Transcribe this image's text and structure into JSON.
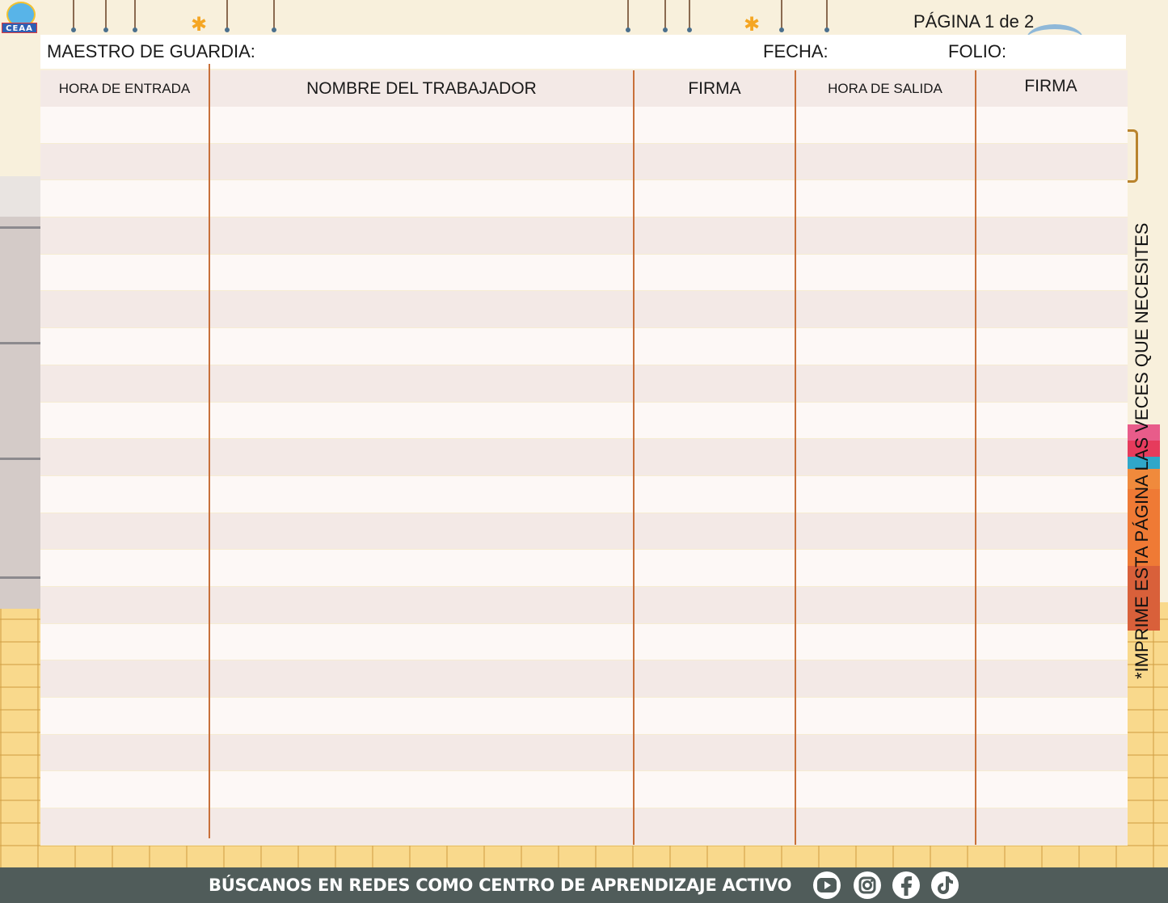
{
  "logo": {
    "text": "CEAA"
  },
  "page_label": "PÁGINA 1 de 2",
  "header": {
    "teacher_label": "MAESTRO DE GUARDIA:",
    "date_label": "FECHA:",
    "folio_label": "FOLIO:"
  },
  "table": {
    "columns": [
      "HORA DE ENTRADA",
      "NOMBRE DEL TRABAJADOR",
      "FIRMA",
      "HORA DE SALIDA",
      "FIRMA"
    ],
    "blank_rows": 20
  },
  "side_note": "*IMPRIME ESTA PÁGINA LAS VECES QUE NECESITES",
  "footer": {
    "text": "BÚSCANOS EN REDES COMO CENTRO DE APRENDIZAJE ACTIVO",
    "social_icons": [
      "youtube-icon",
      "instagram-icon",
      "facebook-icon",
      "tiktok-icon"
    ]
  },
  "colors": {
    "column_divider": "#c8703a",
    "footer_bg": "#505c5a",
    "row_stripe": "#f3e9e6"
  }
}
